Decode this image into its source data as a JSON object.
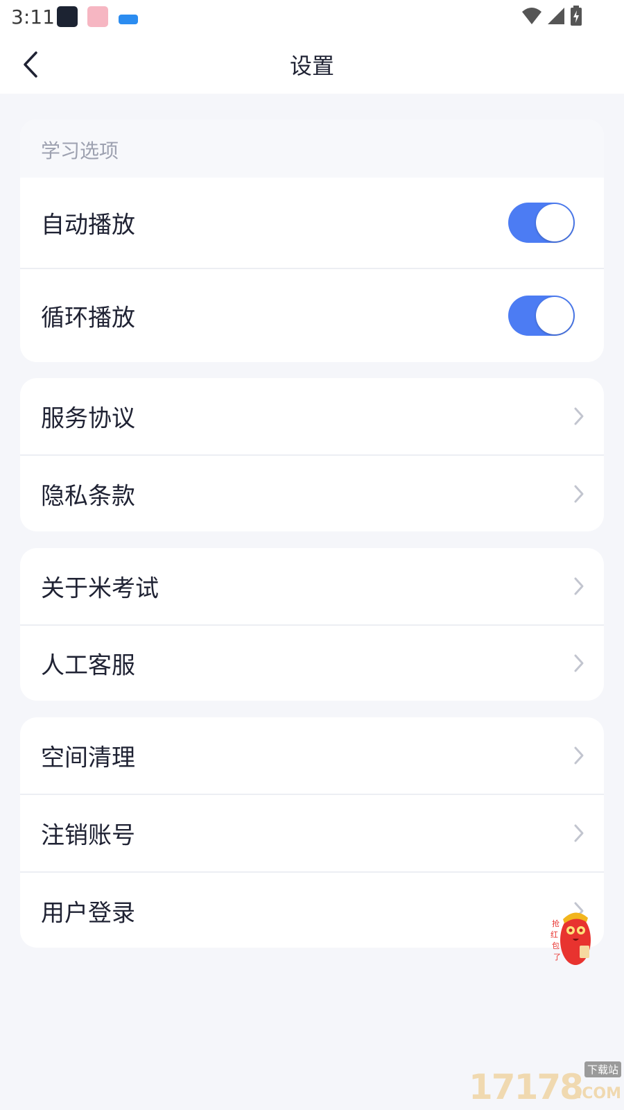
{
  "status_bar": {
    "time": "3:11"
  },
  "header": {
    "title": "设置"
  },
  "sections": {
    "study": {
      "header": "学习选项",
      "rows": [
        {
          "label": "自动播放",
          "toggle_on": true
        },
        {
          "label": "循环播放",
          "toggle_on": true
        }
      ]
    },
    "legal": {
      "rows": [
        {
          "label": "服务协议"
        },
        {
          "label": "隐私条款"
        }
      ]
    },
    "about": {
      "rows": [
        {
          "label": "关于米考试"
        },
        {
          "label": "人工客服"
        }
      ]
    },
    "account": {
      "rows": [
        {
          "label": "空间清理"
        },
        {
          "label": "注销账号"
        },
        {
          "label": "用户登录"
        }
      ]
    }
  },
  "colors": {
    "accent": "#4c7cf3",
    "background": "#f5f6fa",
    "card": "#ffffff"
  },
  "icons": {
    "back": "chevron-left-icon",
    "row_arrow": "chevron-right-icon"
  },
  "overlay": {
    "mascot_text": "抢红包了"
  },
  "watermark": {
    "number": "17178",
    "tag": "下载站",
    "suffix": ".COM"
  }
}
